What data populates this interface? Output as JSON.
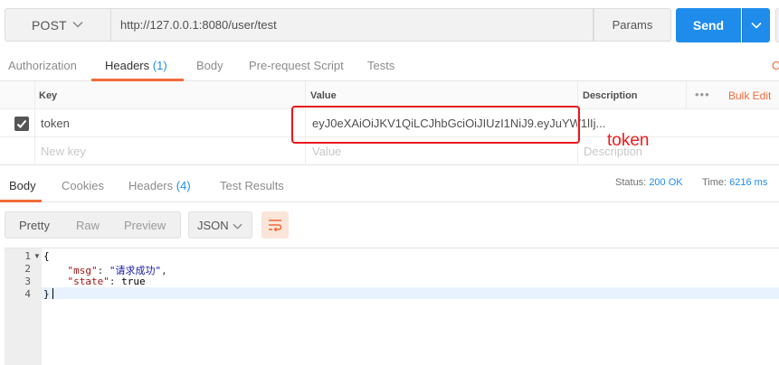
{
  "request": {
    "method": "POST",
    "url": "http://127.0.0.1:8080/user/test",
    "params_label": "Params",
    "send_label": "Send"
  },
  "request_tabs": {
    "authorization": "Authorization",
    "headers": "Headers",
    "headers_count": "(1)",
    "body": "Body",
    "prerequest": "Pre-request Script",
    "tests": "Tests",
    "cut_label": "C"
  },
  "headers_table": {
    "col_key": "Key",
    "col_value": "Value",
    "col_description": "Description",
    "more_dots": "•••",
    "bulk_edit": "Bulk Edit",
    "row": {
      "key": "token",
      "value": "eyJ0eXAiOiJKV1QiLCJhbGciOiJIUzI1NiJ9.eyJuYW1lIj..."
    },
    "new_key_placeholder": "New key",
    "value_placeholder": "Value",
    "description_placeholder": "Description"
  },
  "annotation": {
    "label": "token"
  },
  "response_tabs": {
    "body": "Body",
    "cookies": "Cookies",
    "headers": "Headers",
    "headers_count": "(4)",
    "test_results": "Test Results",
    "status_label": "Status:",
    "status_value": "200 OK",
    "time_label": "Time:",
    "time_value": "6216 ms"
  },
  "response_toolbar": {
    "pretty": "Pretty",
    "raw": "Raw",
    "preview": "Preview",
    "format": "JSON"
  },
  "editor": {
    "line_numbers": [
      "1",
      "2",
      "3",
      "4"
    ],
    "lines": {
      "open": "{",
      "msg_key": "\"msg\"",
      "msg_val": "\"请求成功\"",
      "state_key": "\"state\"",
      "state_val": "true",
      "close": "}"
    }
  },
  "colors": {
    "accent": "#f26b3a",
    "send": "#1f8ceb",
    "highlight": "#e8151b"
  }
}
